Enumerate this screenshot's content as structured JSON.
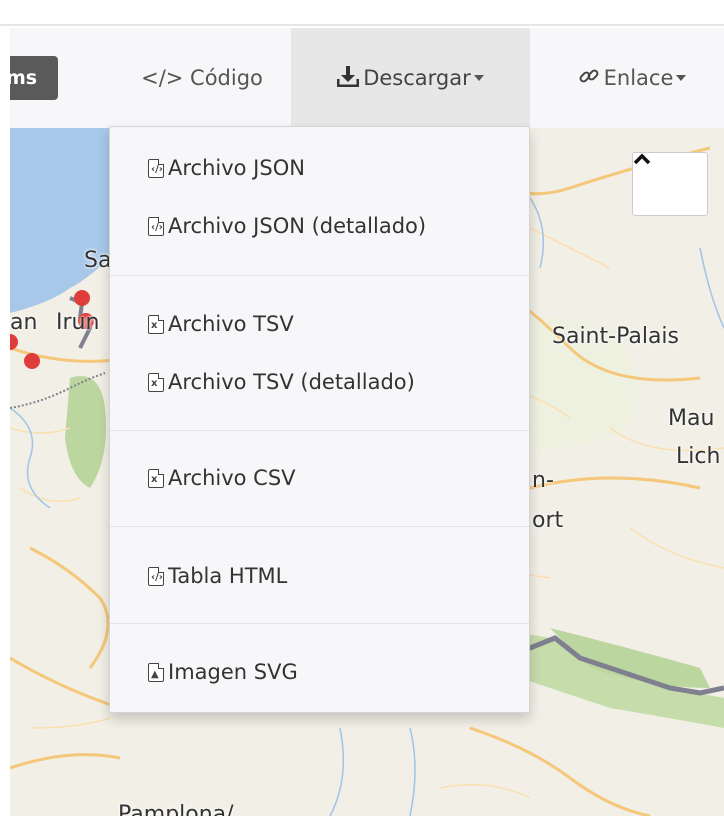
{
  "toolbar": {
    "chip_label": "ms",
    "codigo_label": "</> Código",
    "descargar_label": "Descargar",
    "enlace_label": "Enlace"
  },
  "map": {
    "labels": {
      "sa": "Sa",
      "an": "an",
      "irun": "Irun",
      "saint_palais": "Saint-Palais",
      "mau": "Mau",
      "lich": "Lich",
      "n_dash": "n-",
      "ort": "ort",
      "pamplona": "Pamplona/"
    }
  },
  "download_menu": {
    "items": [
      {
        "label": "Archivo JSON",
        "icon": "code-file-icon"
      },
      {
        "label": "Archivo JSON (detallado)",
        "icon": "code-file-icon"
      },
      {
        "label": "Archivo TSV",
        "icon": "spreadsheet-file-icon"
      },
      {
        "label": "Archivo TSV (detallado)",
        "icon": "spreadsheet-file-icon"
      },
      {
        "label": "Archivo CSV",
        "icon": "spreadsheet-file-icon"
      },
      {
        "label": "Tabla HTML",
        "icon": "code-file-icon"
      },
      {
        "label": "Imagen SVG",
        "icon": "image-file-icon"
      }
    ]
  },
  "colors": {
    "toolbar_bg": "#f7f7f9",
    "active_tab_bg": "#e7e7e7",
    "marker": "#e03c3c"
  }
}
